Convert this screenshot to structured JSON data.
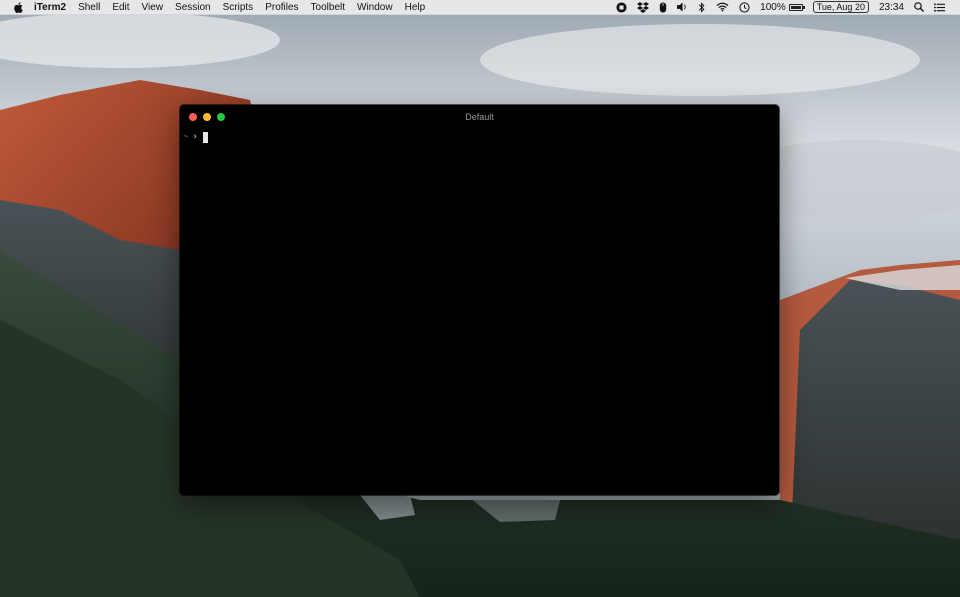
{
  "menubar": {
    "apple_icon": "apple-icon",
    "app_name": "iTerm2",
    "menus": [
      "Shell",
      "Edit",
      "View",
      "Session",
      "Scripts",
      "Profiles",
      "Toolbelt",
      "Window",
      "Help"
    ],
    "status": {
      "battery_percent": "100%",
      "battery_level": 1.0,
      "date": "Tue, Aug 20",
      "time": "23:34",
      "icons": [
        "record-icon",
        "dropbox-icon",
        "mouse-icon",
        "volume-icon",
        "bluetooth-icon",
        "wifi-icon",
        "time-machine-icon",
        "battery-icon",
        "spotlight-icon",
        "notification-center-icon"
      ]
    }
  },
  "window": {
    "title": "Default",
    "prompt_dir": "~",
    "prompt_symbol": "›"
  },
  "colors": {
    "terminal_bg": "#000000",
    "close": "#fc5f57",
    "minimize": "#fdbc2e",
    "maximize": "#28c840"
  }
}
